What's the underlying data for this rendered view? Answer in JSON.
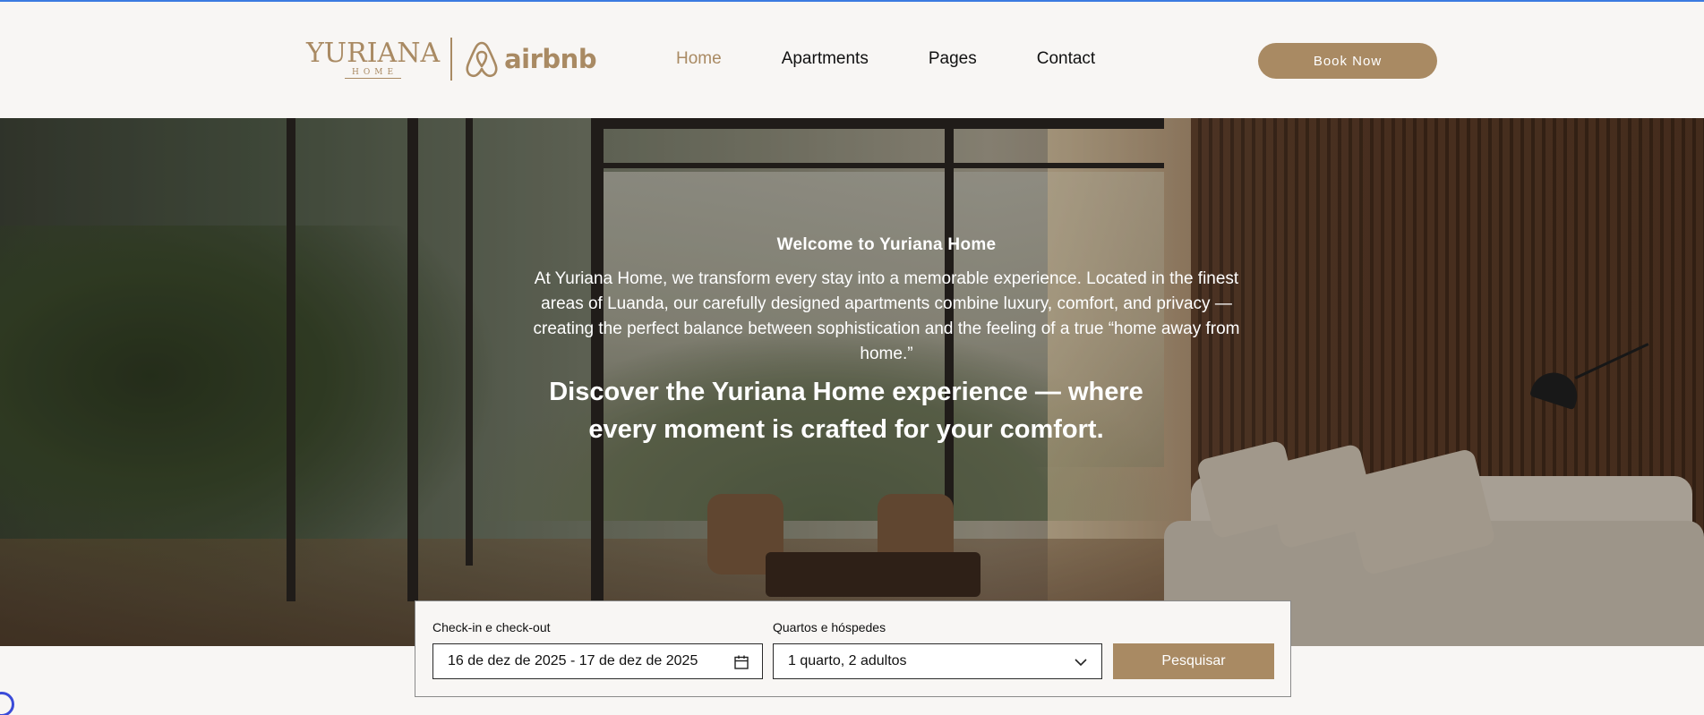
{
  "brand": {
    "logo_word": "YURIANA",
    "logo_sub": "HOME",
    "partner_word": "airbnb",
    "accent_color": "#a98a63"
  },
  "nav": {
    "items": [
      {
        "label": "Home",
        "active": true
      },
      {
        "label": "Apartments",
        "active": false
      },
      {
        "label": "Pages",
        "active": false
      },
      {
        "label": "Contact",
        "active": false
      }
    ],
    "cta_label": "Book Now"
  },
  "hero": {
    "title": "Welcome to Yuriana Home",
    "description": "At Yuriana Home, we transform every stay into a memorable experience. Located in the finest areas of Luanda, our carefully designed apartments combine luxury, comfort, and privacy — creating the perfect balance between sophistication and the feeling of a true “home away from home.”",
    "headline": "Discover the Yuriana Home experience — where every moment is crafted for your comfort."
  },
  "booking": {
    "dates_label": "Check-in e check-out",
    "dates_value": "16 de dez de 2025 - 17 de dez de 2025",
    "dates_icon": "calendar-icon",
    "guests_label": "Quartos e hóspedes",
    "guests_value": "1 quarto, 2 adultos",
    "guests_icon": "chevron-down-icon",
    "search_label": "Pesquisar"
  }
}
